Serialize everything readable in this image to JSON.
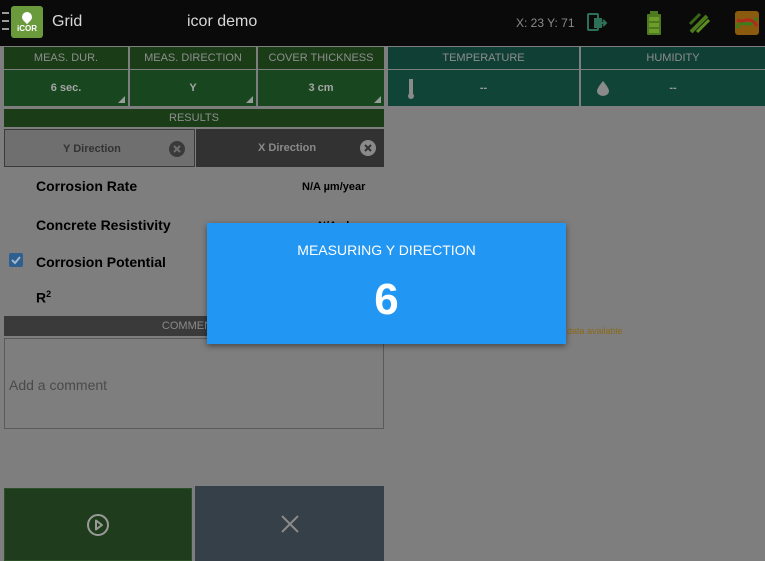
{
  "topbar": {
    "app_title": "Grid",
    "project_title": "icor demo",
    "coords": "X: 23 Y: 71",
    "logo_text": "iCOR",
    "icons": [
      "menu-icon",
      "sync-icon",
      "battery-icon",
      "signal-icon",
      "map-icon"
    ]
  },
  "measurement": {
    "dur_label": "MEAS. DUR.",
    "dur_value": "6 sec.",
    "dir_label": "MEAS. DIRECTION",
    "dir_value": "Y",
    "cover_label": "COVER THICKNESS",
    "cover_value": "3 cm"
  },
  "environment": {
    "temp_label": "TEMPERATURE",
    "temp_value": "--",
    "hum_label": "HUMIDITY",
    "hum_value": "--"
  },
  "results": {
    "header": "RESULTS",
    "tabs": [
      {
        "label": "Y Direction",
        "active": true
      },
      {
        "label": "X Direction",
        "active": false
      }
    ],
    "rows": [
      {
        "label": "Corrosion Rate",
        "value": "N/A µm/year"
      },
      {
        "label": "Concrete Resistivity",
        "value": "N/A ohm.m"
      },
      {
        "label": "Corrosion Potential",
        "value": "",
        "checked": true
      },
      {
        "label": "R",
        "sup": "2",
        "value": ""
      }
    ]
  },
  "comments": {
    "header": "COMMENTS",
    "placeholder": "Add a comment"
  },
  "chart": {
    "no_data": "data available"
  },
  "modal": {
    "title": "MEASURING Y DIRECTION",
    "countdown": "6"
  },
  "colors": {
    "modal_bg": "#2196f3",
    "header_green": "#1a3d18",
    "env_teal": "#0f4437",
    "overlay": "#7e7e7e"
  }
}
